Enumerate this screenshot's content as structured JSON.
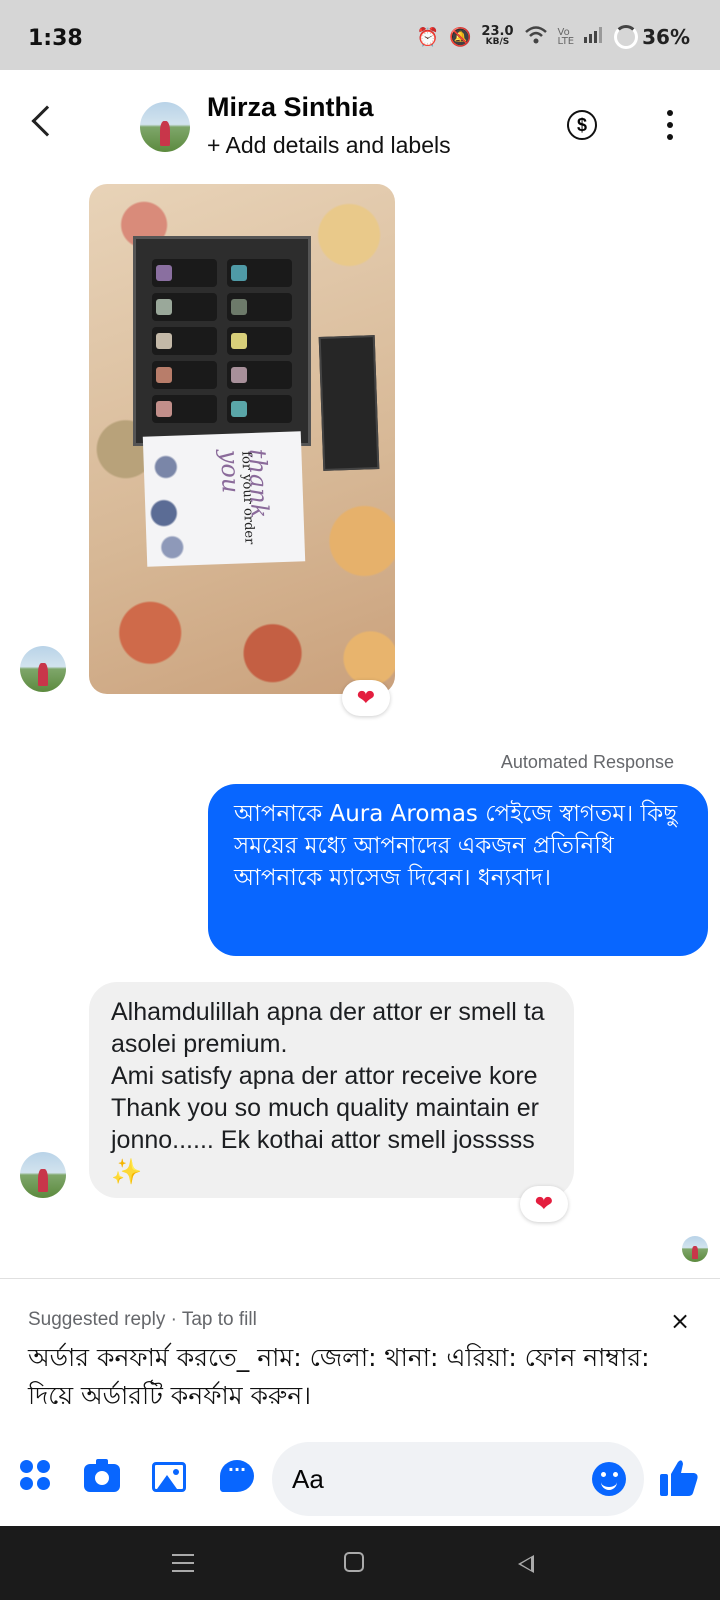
{
  "status_bar": {
    "time": "1:38",
    "speed_value": "23.0",
    "speed_unit": "KB/S",
    "network_top": "Vo",
    "network_bottom": "LTE",
    "battery": "36%"
  },
  "header": {
    "contact_name": "Mirza Sinthia",
    "subtitle": "+ Add details and labels",
    "payment_icon": "dollar-circle-icon",
    "more_icon": "vertical-dots-icon",
    "back_icon": "chevron-left-icon"
  },
  "photo_message": {
    "card_text": "for your order",
    "card_script": "thank you",
    "reaction": "❤️"
  },
  "auto_response": {
    "label": "Automated Response",
    "text": "আপনাকে Aura Aromas পেইজে স্বাগতম। কিছু সময়ের মধ্যে আপনাদের একজন প্রতিনিধি আপনাকে ম্যাসেজ দিবেন। ধন্যবাদ।"
  },
  "incoming_message": {
    "text": "Alhamdulillah apna der attor er smell ta asolei premium.\nAmi satisfy apna der attor receive kore Thank you so much quality maintain er jonno...... Ek kothai attor smell josssss ✨",
    "reaction": "❤️"
  },
  "suggested_reply": {
    "label": "Suggested reply · Tap to fill",
    "close": "×",
    "text": "অর্ডার কনফার্ম করতে_ নাম: জেলা: থানা: এরিয়া: ফোন নাম্বার: দিয়ে অর্ডারটি কনর্ফাম করুন।"
  },
  "composer": {
    "placeholder": "Aa",
    "accent": "#0866ff"
  },
  "colors": {
    "brand_blue": "#0866ff",
    "incoming_bubble": "#f0f0f0",
    "status_bar": "#d6d6d6",
    "nav_bar": "#1b1b1b"
  }
}
